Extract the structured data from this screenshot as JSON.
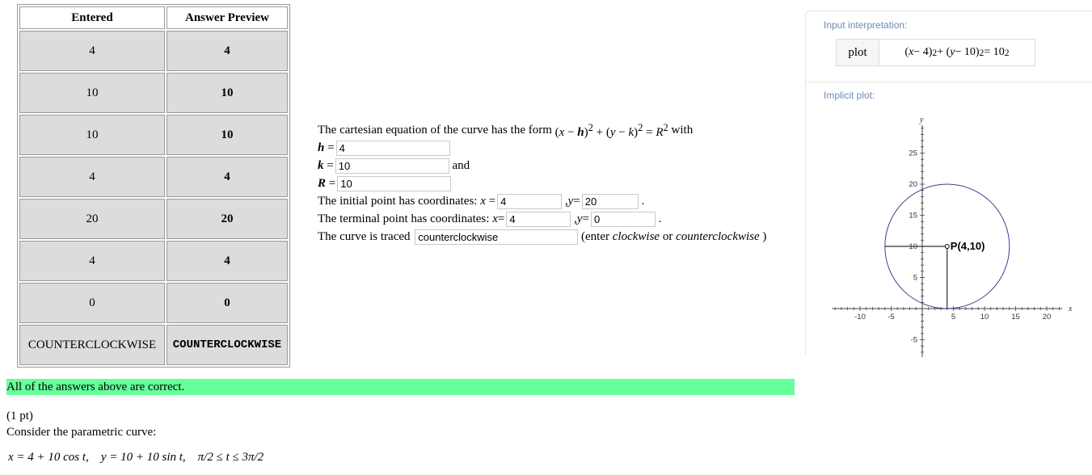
{
  "answers_table": {
    "headers": [
      "Entered",
      "Answer Preview"
    ],
    "rows": [
      {
        "entered": "4",
        "preview": "4"
      },
      {
        "entered": "10",
        "preview": "10"
      },
      {
        "entered": "10",
        "preview": "10"
      },
      {
        "entered": "4",
        "preview": "4"
      },
      {
        "entered": "20",
        "preview": "20"
      },
      {
        "entered": "4",
        "preview": "4"
      },
      {
        "entered": "0",
        "preview": "0"
      },
      {
        "entered": "COUNTERCLOCKWISE",
        "preview": "COUNTERCLOCKWISE"
      }
    ]
  },
  "form": {
    "line1_text": "The cartesian equation of the curve has the form",
    "line1_with": "with",
    "h_value": "4",
    "k_value": "10",
    "k_and": "and",
    "R_value": "10",
    "initial_text": "The initial point has coordinates:",
    "initial_x": "4",
    "initial_y": "20",
    "terminal_text": "The terminal point has coordinates:",
    "terminal_x": "4",
    "terminal_y": "0",
    "traced_text": "The curve is traced",
    "traced_value": "counterclockwise",
    "traced_hint_pre": "(enter",
    "traced_hint_cw": "clockwise",
    "traced_hint_or": "or",
    "traced_hint_ccw": "counterclockwise",
    "traced_hint_post": ")"
  },
  "banner": "All of the answers above are correct.",
  "problem": {
    "points": "(1 pt)",
    "prompt": "Consider the parametric curve:"
  },
  "wolfram": {
    "input_label": "Input interpretation:",
    "plot_key": "plot",
    "plot_label": "Implicit plot:",
    "point_label": "P(4,10)",
    "x_axis_label": "x",
    "y_axis_label": "y",
    "x_ticks": [
      "-10",
      "-5",
      "5",
      "10",
      "15",
      "20"
    ],
    "y_ticks": [
      "-5",
      "5",
      "10",
      "15",
      "20",
      "25"
    ],
    "circle": {
      "h": 4,
      "k": 10,
      "r": 10
    },
    "colors": {
      "curve": "#3a3f8f",
      "label": "#6b8bb3"
    }
  }
}
